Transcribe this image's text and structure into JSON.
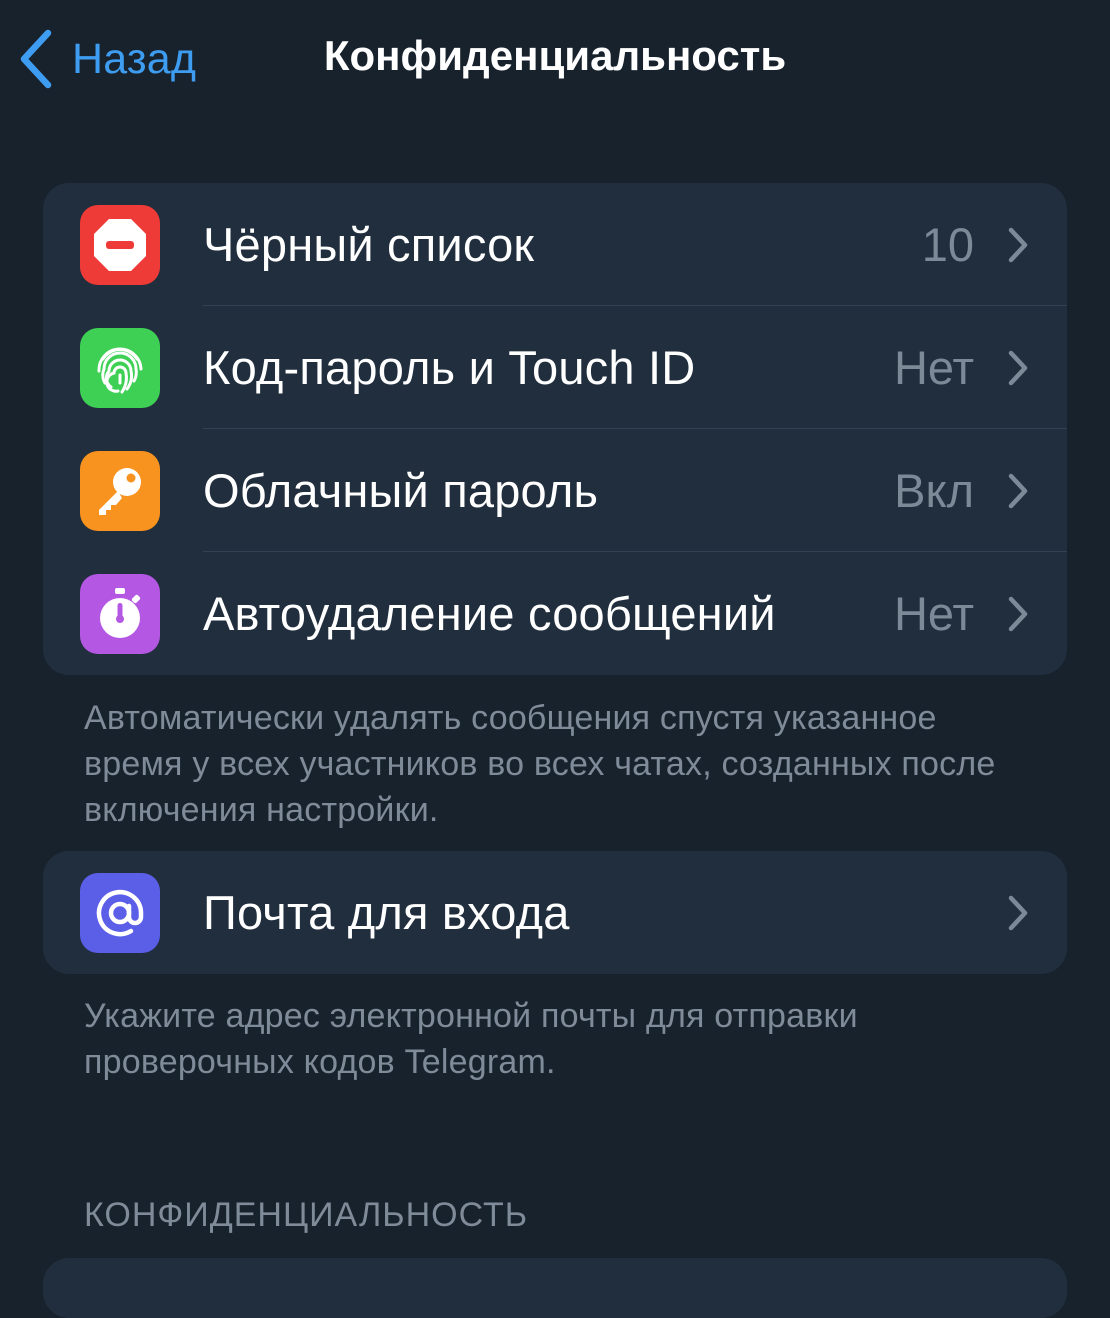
{
  "nav": {
    "back_label": "Назад",
    "title": "Конфиденциальность"
  },
  "security_group": {
    "items": [
      {
        "label": "Чёрный список",
        "value": "10",
        "icon": "blocked-icon",
        "color": "#ee3b38"
      },
      {
        "label": "Код-пароль и Touch ID",
        "value": "Нет",
        "icon": "fingerprint-icon",
        "color": "#3ecf55"
      },
      {
        "label": "Облачный пароль",
        "value": "Вкл",
        "icon": "key-icon",
        "color": "#f7931e"
      },
      {
        "label": "Автоудаление сообщений",
        "value": "Нет",
        "icon": "timer-icon",
        "color": "#b457e3"
      }
    ],
    "footer": "Автоматически удалять сообщения спустя указанное время у всех участников во всех чатах, созданных после включения настройки."
  },
  "email_group": {
    "items": [
      {
        "label": "Почта для входа",
        "value": "",
        "icon": "at-sign-icon",
        "color": "#5b5fe8"
      }
    ],
    "footer": "Укажите адрес электронной почты для отправки проверочных кодов Telegram."
  },
  "privacy_section": {
    "header": "КОНФИДЕНЦИАЛЬНОСТЬ"
  },
  "colors": {
    "background": "#18222d",
    "cell": "#212e3d",
    "accent": "#3e9cf1",
    "secondary_text": "#7f8b98"
  }
}
